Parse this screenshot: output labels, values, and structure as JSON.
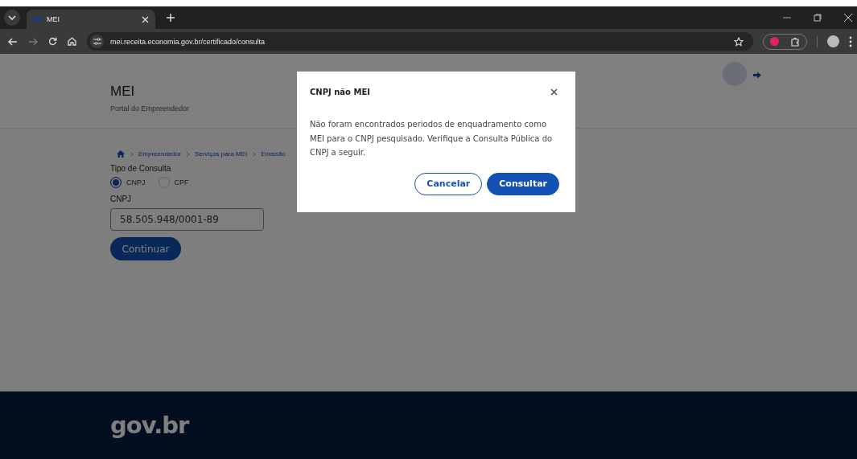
{
  "browser": {
    "tabs": [
      {
        "title": "MEI",
        "selected": true
      }
    ],
    "url": "mei.receita.economia.gov.br/certificado/consulta"
  },
  "header": {
    "title": "MEI",
    "subtitle": "Portal do Empreendedor"
  },
  "breadcrumb": [
    "Empreendedor",
    "Serviços para MEI",
    "Emissão"
  ],
  "form": {
    "type_label": "Tipo de Consulta",
    "options": [
      {
        "label": "CNPJ",
        "selected": true
      },
      {
        "label": "CPF",
        "selected": false
      }
    ],
    "field_label": "CNPJ",
    "field_value": "58.505.948/0001-89",
    "submit": "Continuar"
  },
  "dialog": {
    "title": "CNPJ não MEI",
    "message": "Não foram encontrados periodos de enquadramento como MEI para o CNPJ pesquisado. Verifique a Consulta Pública do CNPJ a seguir.",
    "buttons": [
      {
        "label": "Cancelar",
        "kind": "secondary"
      },
      {
        "label": "Consultar",
        "kind": "primary"
      }
    ]
  },
  "footer": {
    "logo": "gov.br"
  }
}
